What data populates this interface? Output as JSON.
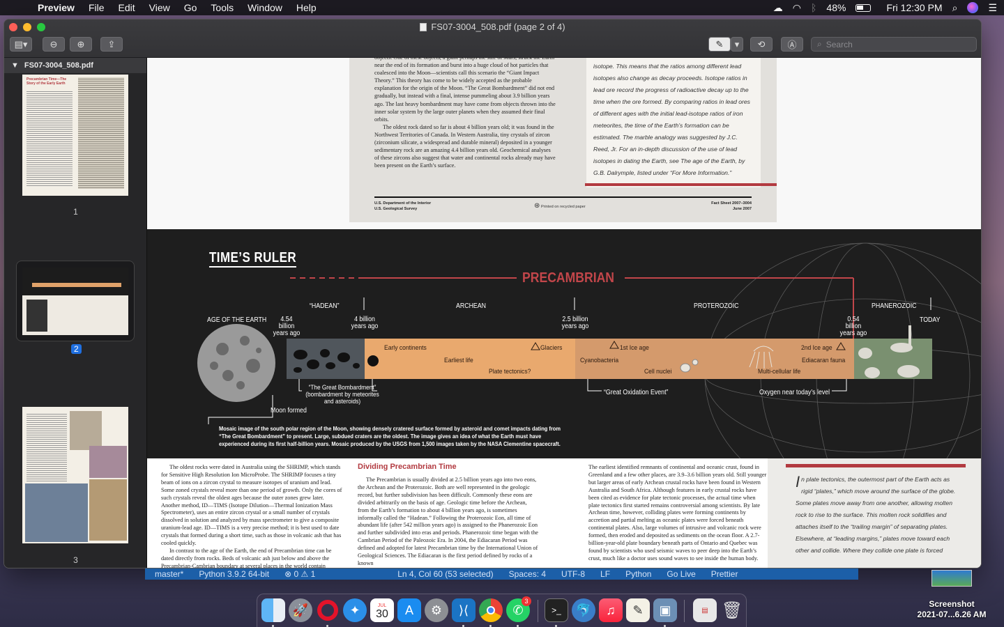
{
  "menubar": {
    "app": "Preview",
    "items": [
      "File",
      "Edit",
      "View",
      "Go",
      "Tools",
      "Window",
      "Help"
    ],
    "battery": "48%",
    "clock": "Fri 12:30 PM"
  },
  "window": {
    "title": "FS07-3004_508.pdf (page 2 of 4)",
    "search_placeholder": "Search"
  },
  "sidebar": {
    "file": "FS07-3004_508.pdf",
    "thumbs": [
      {
        "num": "1"
      },
      {
        "num": "2"
      },
      {
        "num": "3"
      }
    ],
    "thumb1_title": "Precambrian Time—The Story of the Early Earth"
  },
  "page1": {
    "col_text": "objects. One of these objects, a giant perhaps the size of Mars, struck the Earth near the end of its formation and burst into a huge cloud of hot particles that coalesced into the Moon—scientists call this scenario the “Giant Impact Theory.” This theory has come to be widely accepted as the probable explanation for the origin of the Moon. “The Great Bombardment” did not end gradually, but instead with a final, intense pummeling about 3.9 billion years ago. The last heavy bombardment may have come from objects thrown into the inner solar system by the large outer planets when they assumed their final orbits.",
    "col_text2": "The oldest rock dated so far is about 4 billion years old; it was found in the Northwest Territories of Canada. In Western Australia, tiny crystals of zircon (zirconium silicate, a widespread and durable mineral) deposited in a younger sedimentary rock are an amazing 4.4 billion years old. Geochemical analyses of these zircons also suggest that water and continental rocks already may have been present on the Earth’s surface.",
    "quote": "isotope. This means that the ratios among different lead isotopes also change as decay proceeds. Isotope ratios in lead ore record the progress of radioactive decay up to the time when the ore formed. By comparing ratios in lead ores of different ages with the initial lead-isotope ratios of iron meteorites, the time of the Earth’s formation can be estimated. The marble analogy was suggested by J.C. Reed, Jr. For an in-depth discussion of the use of lead isotopes in dating the Earth, see The age of the Earth, by G.B. Dalrymple, listed under “For More Information.”",
    "foot_left1": "U.S. Department of the Interior",
    "foot_left2": "U.S. Geological Survey",
    "foot_center": "Printed on recycled paper",
    "foot_right1": "Fact Sheet 2007–3004",
    "foot_right2": "June 2007"
  },
  "timeline": {
    "title": "TIME’S RULER",
    "precambrian": "PRECAMBRIAN",
    "eras": {
      "hadean": "“HADEAN”",
      "archean": "ARCHEAN",
      "proterozoic": "PROTEROZOIC",
      "phanerozoic": "PHANEROZOIC"
    },
    "age_label": "AGE OF THE EARTH",
    "t454": "4.54 billion years ago",
    "t4": "4 billion years ago",
    "t25": "2.5 billion years ago",
    "t054": "0.54 billion years ago",
    "today": "TODAY",
    "events": {
      "early_continents": "Early continents",
      "earliest_life": "Earliest life",
      "plate_tectonics": "Plate tectonics?",
      "glaciers": "Glaciers",
      "first_ice": "1st Ice age",
      "cyanobacteria": "Cyanobacteria",
      "cell_nuclei": "Cell nuclei",
      "multicellular": "Multi-cellular life",
      "second_ice": "2nd Ice age",
      "ediacaran": "Ediacaran fauna",
      "bombardment": "“The Great Bombardment” (bombardment by meteorites and asteroids)",
      "moon_formed": "Moon formed",
      "goe": "“Great Oxidation Event”",
      "oxygen": "Oxygen near today’s level"
    },
    "caption": "Mosaic image of the south polar region of the Moon, showing densely cratered surface formed by asteroid and comet impacts dating from “The Great Bombardment” to present. Large, subdued craters are the oldest. The image gives an idea of what the Earth must have experienced during its first half-billion years. Mosaic produced by the USGS from 1,500 images taken by the NASA Clementine spacecraft."
  },
  "page3": {
    "col1": "The oldest rocks were dated in Australia using the SHRIMP, which stands for Sensitive High Resolution Ion MicroProbe. The SHRIMP focuses a tiny beam of ions on a zircon crystal to measure isotopes of uranium and lead. Some zoned crystals reveal more than one period of growth. Only the cores of such crystals reveal the oldest ages because the outer zones grew later. Another method, ID—TIMS (Isotope Dilution—Thermal Ionization Mass Spectrometer), uses an entire zircon crystal or a small number of crystals dissolved in solution and analyzed by mass spectrometer to give a composite uranium-lead age. ID—TIMS is a very precise method; it is best used to date crystals that formed during a short time, such as those in volcanic ash that has cooled quickly.",
    "col1b": "In contrast to the age of the Earth, the end of Precambrian time can be dated directly from rocks. Beds of volcanic ash just below and above the Precambrian-Cambrian boundary at several places in the world contain",
    "heading": "Dividing Precambrian Time",
    "col2": "The Precambrian is usually divided at 2.5 billion years ago into two eons, the Archean and the Proterozoic. Both are well represented in the geologic record, but further subdivision has been difficult. Commonly these eons are divided arbitrarily on the basis of age. Geologic time before the Archean, from the Earth’s formation to about 4 billion years ago, is sometimes informally called the “Hadean.” Following the Proterozoic Eon, all time of abundant life (after 542 million years ago) is assigned to the Phanerozoic Eon and further subdivided into eras and periods. Phanerozoic time began with the Cambrian Period of the Paleozoic Era. In 2004, the Ediacaran Period was defined and adopted for latest Precambrian time by the International Union of Geological Sciences. The Ediacaran is the first period defined by rocks of a known",
    "col3": "The earliest identified remnants of continental and oceanic crust, found in Greenland and a few other places, are 3.9–3.6 billion years old. Still younger but larger areas of early Archean crustal rocks have been found in Western Australia and South Africa. Although features in early crustal rocks have been cited as evidence for plate tectonic processes, the actual time when plate tectonics first started remains controversial among scientists. By late Archean time, however, colliding plates were forming continents by accretion and partial melting as oceanic plates were forced beneath continental plates. Also, large volumes of intrusive and volcanic rock were formed, then eroded and deposited as sediments on the ocean floor. A 2.7-billion-year-old plate boundary beneath parts of Ontario and Quebec was found by scientists who used seismic waves to peer deep into the Earth’s crust, much like a doctor uses sound waves to see inside the human body.",
    "quote_initial": "I",
    "quote": "n plate tectonics, the outermost part of the Earth acts as rigid “plates,” which move around the surface of the globe. Some plates move away from one another, allowing molten rock to rise to the surface. This molten rock solidifies and attaches itself to the “trailing margin” of separating plates. Elsewhere, at “leading margins,” plates move toward each other and collide. Where they collide one plate is forced"
  },
  "vscode_status": [
    "master*",
    "Python 3.9.2 64-bit",
    "⊗ 0 ⚠ 1",
    "Ln 4, Col 60 (53 selected)",
    "Spaces: 4",
    "UTF-8",
    "LF",
    "Python",
    "Go Live",
    "Prettier"
  ],
  "desktop": {
    "screenshot_label": "Screenshot",
    "screenshot_date": "2021-07...6.26 AM"
  },
  "dock": {
    "calendar_month": "JUL",
    "calendar_day": "30",
    "whatsapp_badge": "3"
  }
}
